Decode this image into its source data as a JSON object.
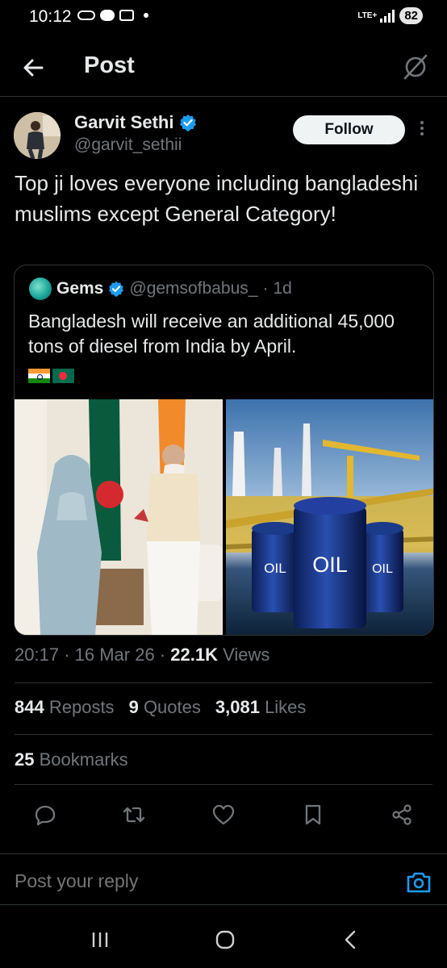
{
  "status_bar": {
    "time": "10:12",
    "network": "LTE+",
    "battery": "82"
  },
  "header": {
    "title": "Post"
  },
  "post": {
    "author_name": "Garvit Sethi",
    "author_handle": "@garvit_sethii",
    "verified": true,
    "follow_label": "Follow",
    "text": "Top ji loves everyone including bangladeshi muslims except General Category!",
    "quote": {
      "name": "Gems",
      "handle": "@gemsofbabus_",
      "separator": "·",
      "age": "1d",
      "text": "Bangladesh will receive an additional 45,000 tons of diesel from India by April.",
      "flags": [
        "🇮🇳",
        "🇧🇩"
      ],
      "images": [
        {
          "label": "photo-two-leaders"
        },
        {
          "label": "photo-oil-barrels",
          "barrel_text": "OIL"
        }
      ]
    },
    "meta": {
      "time": "20:17",
      "dot1": "·",
      "date": "16 Mar 26",
      "dot2": "·",
      "views_count": "22.1K",
      "views_label": "Views"
    },
    "stats": {
      "reposts_count": "844",
      "reposts_label": "Reposts",
      "quotes_count": "9",
      "quotes_label": "Quotes",
      "likes_count": "3,081",
      "likes_label": "Likes",
      "bookmarks_count": "25",
      "bookmarks_label": "Bookmarks"
    }
  },
  "actions": [
    "reply-icon",
    "repost-icon",
    "like-icon",
    "bookmark-icon",
    "share-icon"
  ],
  "reply": {
    "placeholder": "Post your reply"
  },
  "colors": {
    "background": "#000000",
    "text": "#e7e9ea",
    "secondary": "#71767b",
    "accent": "#1d9bf0",
    "border": "#2f3336"
  }
}
